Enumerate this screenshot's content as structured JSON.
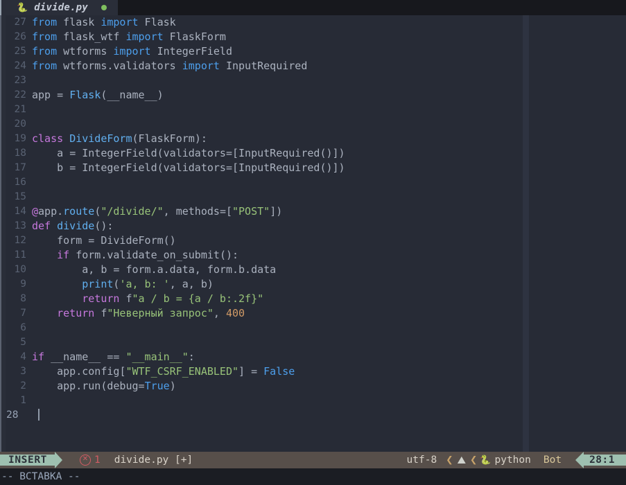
{
  "tabline": {
    "tabs": [
      {
        "icon": "python-icon",
        "icon_glyph": "🐍",
        "name": "divide.py",
        "modified_dot": true
      }
    ]
  },
  "editor": {
    "current_line_number": "28",
    "lines": [
      {
        "num": "27",
        "tokens": [
          {
            "t": "from",
            "c": "kw2"
          },
          {
            "t": " flask ",
            "c": "id"
          },
          {
            "t": "import",
            "c": "kw2"
          },
          {
            "t": " Flask",
            "c": "id"
          }
        ]
      },
      {
        "num": "26",
        "tokens": [
          {
            "t": "from",
            "c": "kw2"
          },
          {
            "t": " flask_wtf ",
            "c": "id"
          },
          {
            "t": "import",
            "c": "kw2"
          },
          {
            "t": " FlaskForm",
            "c": "id"
          }
        ]
      },
      {
        "num": "25",
        "tokens": [
          {
            "t": "from",
            "c": "kw2"
          },
          {
            "t": " wtforms ",
            "c": "id"
          },
          {
            "t": "import",
            "c": "kw2"
          },
          {
            "t": " IntegerField",
            "c": "id"
          }
        ]
      },
      {
        "num": "24",
        "tokens": [
          {
            "t": "from",
            "c": "kw2"
          },
          {
            "t": " wtforms.validators ",
            "c": "id"
          },
          {
            "t": "import",
            "c": "kw2"
          },
          {
            "t": " InputRequired",
            "c": "id"
          }
        ]
      },
      {
        "num": "23",
        "tokens": []
      },
      {
        "num": "22",
        "tokens": [
          {
            "t": "app ",
            "c": "id"
          },
          {
            "t": "=",
            "c": "op"
          },
          {
            "t": " ",
            "c": "id"
          },
          {
            "t": "Flask",
            "c": "fn"
          },
          {
            "t": "(",
            "c": "punct"
          },
          {
            "t": "__name__",
            "c": "id"
          },
          {
            "t": ")",
            "c": "punct"
          }
        ]
      },
      {
        "num": "21",
        "tokens": []
      },
      {
        "num": "20",
        "tokens": []
      },
      {
        "num": "19",
        "tokens": [
          {
            "t": "class",
            "c": "kw"
          },
          {
            "t": " ",
            "c": "id"
          },
          {
            "t": "DivideForm",
            "c": "cls"
          },
          {
            "t": "(",
            "c": "punct"
          },
          {
            "t": "FlaskForm",
            "c": "id"
          },
          {
            "t": "):",
            "c": "punct"
          }
        ]
      },
      {
        "num": "18",
        "tokens": [
          {
            "t": "    a ",
            "c": "id"
          },
          {
            "t": "=",
            "c": "op"
          },
          {
            "t": " ",
            "c": "id"
          },
          {
            "t": "IntegerField",
            "c": "id"
          },
          {
            "t": "(",
            "c": "punct"
          },
          {
            "t": "validators",
            "c": "id"
          },
          {
            "t": "=[",
            "c": "punct"
          },
          {
            "t": "InputRequired",
            "c": "id"
          },
          {
            "t": "()])",
            "c": "punct"
          }
        ]
      },
      {
        "num": "17",
        "tokens": [
          {
            "t": "    b ",
            "c": "id"
          },
          {
            "t": "=",
            "c": "op"
          },
          {
            "t": " ",
            "c": "id"
          },
          {
            "t": "IntegerField",
            "c": "id"
          },
          {
            "t": "(",
            "c": "punct"
          },
          {
            "t": "validators",
            "c": "id"
          },
          {
            "t": "=[",
            "c": "punct"
          },
          {
            "t": "InputRequired",
            "c": "id"
          },
          {
            "t": "()])",
            "c": "punct"
          }
        ]
      },
      {
        "num": "16",
        "tokens": []
      },
      {
        "num": "15",
        "tokens": []
      },
      {
        "num": "14",
        "tokens": [
          {
            "t": "@",
            "c": "at"
          },
          {
            "t": "app",
            "c": "id"
          },
          {
            "t": ".",
            "c": "punct"
          },
          {
            "t": "route",
            "c": "fn"
          },
          {
            "t": "(",
            "c": "punct"
          },
          {
            "t": "\"/divide/\"",
            "c": "str"
          },
          {
            "t": ", methods",
            "c": "id"
          },
          {
            "t": "=[",
            "c": "punct"
          },
          {
            "t": "\"POST\"",
            "c": "str"
          },
          {
            "t": "])",
            "c": "punct"
          }
        ]
      },
      {
        "num": "13",
        "tokens": [
          {
            "t": "def",
            "c": "kw"
          },
          {
            "t": " ",
            "c": "id"
          },
          {
            "t": "divide",
            "c": "fn"
          },
          {
            "t": "():",
            "c": "punct"
          }
        ]
      },
      {
        "num": "12",
        "tokens": [
          {
            "t": "    form ",
            "c": "id"
          },
          {
            "t": "=",
            "c": "op"
          },
          {
            "t": " ",
            "c": "id"
          },
          {
            "t": "DivideForm",
            "c": "id"
          },
          {
            "t": "()",
            "c": "punct"
          }
        ]
      },
      {
        "num": "11",
        "tokens": [
          {
            "t": "    ",
            "c": "id"
          },
          {
            "t": "if",
            "c": "kw"
          },
          {
            "t": " form.validate_on_submit",
            "c": "id"
          },
          {
            "t": "():",
            "c": "punct"
          }
        ]
      },
      {
        "num": "10",
        "tokens": [
          {
            "t": "        a, b ",
            "c": "id"
          },
          {
            "t": "=",
            "c": "op"
          },
          {
            "t": " form.a.data, form.b.data",
            "c": "id"
          }
        ]
      },
      {
        "num": "9",
        "tokens": [
          {
            "t": "        ",
            "c": "id"
          },
          {
            "t": "print",
            "c": "fn"
          },
          {
            "t": "(",
            "c": "punct"
          },
          {
            "t": "'a, b: '",
            "c": "str"
          },
          {
            "t": ", a, b",
            "c": "id"
          },
          {
            "t": ")",
            "c": "punct"
          }
        ]
      },
      {
        "num": "8",
        "tokens": [
          {
            "t": "        ",
            "c": "id"
          },
          {
            "t": "return",
            "c": "kw"
          },
          {
            "t": " f",
            "c": "id"
          },
          {
            "t": "\"a / b = {a / b:.2f}\"",
            "c": "str"
          }
        ]
      },
      {
        "num": "7",
        "tokens": [
          {
            "t": "    ",
            "c": "id"
          },
          {
            "t": "return",
            "c": "kw"
          },
          {
            "t": " f",
            "c": "id"
          },
          {
            "t": "\"Неверный запрос\"",
            "c": "str"
          },
          {
            "t": ", ",
            "c": "punct"
          },
          {
            "t": "400",
            "c": "num-lit"
          }
        ]
      },
      {
        "num": "6",
        "tokens": []
      },
      {
        "num": "5",
        "tokens": []
      },
      {
        "num": "4",
        "tokens": [
          {
            "t": "if",
            "c": "kw"
          },
          {
            "t": " __name__ ",
            "c": "id"
          },
          {
            "t": "==",
            "c": "op"
          },
          {
            "t": " ",
            "c": "id"
          },
          {
            "t": "\"__main__\"",
            "c": "str"
          },
          {
            "t": ":",
            "c": "punct"
          }
        ]
      },
      {
        "num": "3",
        "tokens": [
          {
            "t": "    app.config",
            "c": "id"
          },
          {
            "t": "[",
            "c": "punct"
          },
          {
            "t": "\"WTF_CSRF_ENABLED\"",
            "c": "str"
          },
          {
            "t": "] ",
            "c": "punct"
          },
          {
            "t": "=",
            "c": "op"
          },
          {
            "t": " ",
            "c": "id"
          },
          {
            "t": "False",
            "c": "bool"
          }
        ]
      },
      {
        "num": "2",
        "tokens": [
          {
            "t": "    app.run",
            "c": "id"
          },
          {
            "t": "(",
            "c": "punct"
          },
          {
            "t": "debug",
            "c": "id"
          },
          {
            "t": "=",
            "c": "op"
          },
          {
            "t": "True",
            "c": "bool"
          },
          {
            "t": ")",
            "c": "punct"
          }
        ]
      },
      {
        "num": "1",
        "tokens": []
      }
    ]
  },
  "statusline": {
    "mode": "INSERT",
    "error_icon": "error-circle-x-icon",
    "error_count": "1",
    "filename": "divide.py [+]",
    "encoding": "utf-8",
    "os_icon_glyph": "⛰",
    "separator_glyph": "❮",
    "language_icon_glyph": "🐍",
    "language": "python",
    "scroll_position": "Bot",
    "cursor_position": "28:1"
  },
  "cmdline": {
    "message": "-- ВСТАВКА --"
  },
  "colors": {
    "editor_bg": "#272b36",
    "tab_bg": "#2a2e39",
    "statusline_bg": "#574f4a",
    "mode_accent": "#9ec0b0",
    "error": "#d05c64",
    "modified_dot": "#7fbf5f"
  }
}
